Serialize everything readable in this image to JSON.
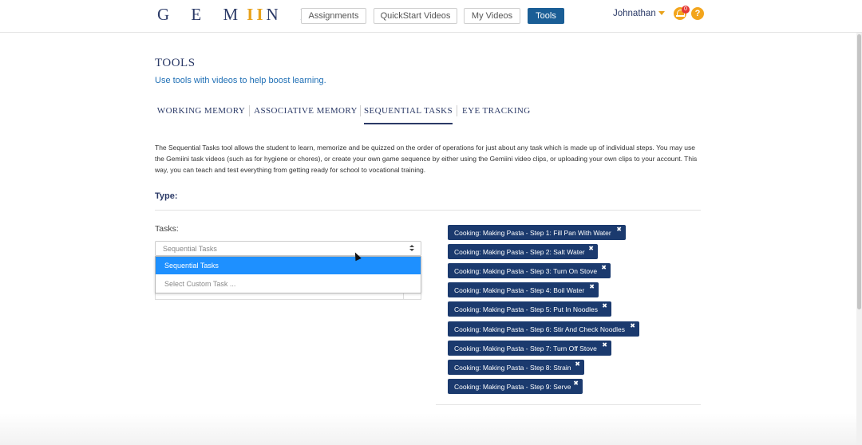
{
  "header": {
    "logo": "GEMIINI",
    "nav": [
      "Assignments",
      "QuickStart Videos",
      "My Videos",
      "Tools"
    ],
    "active_nav": "Tools",
    "user": "Johnathan",
    "notification_count": "0",
    "help_label": "?"
  },
  "page": {
    "title": "TOOLS",
    "subtitle": "Use tools with videos to help boost learning.",
    "tabs": [
      "WORKING MEMORY",
      "ASSOCIATIVE MEMORY",
      "SEQUENTIAL TASKS",
      "EYE TRACKING"
    ],
    "active_tab": "SEQUENTIAL TASKS",
    "description": "The Sequential Tasks tool allows the student to learn, memorize and be quizzed on the order of operations for just about any task which is made up of individual steps. You may use the Gemiini task videos (such as for hygiene or chores), or create your own game sequence by either using the Gemiini video clips, or uploading your own clips to your account. This way, you can teach and test everything from getting ready for school to vocational training.",
    "type_label": "Type:",
    "tasks_label": "Tasks:",
    "select": {
      "value": "Sequential Tasks",
      "options": [
        "Sequential Tasks",
        "Select Custom Task ..."
      ],
      "highlighted": "Sequential Tasks"
    },
    "chips": [
      "Cooking: Making Pasta - Step 1: Fill Pan With Water",
      "Cooking: Making Pasta - Step 2: Salt Water",
      "Cooking: Making Pasta - Step 3: Turn On Stove",
      "Cooking: Making Pasta - Step 4: Boil Water",
      "Cooking: Making Pasta - Step 5: Put In Noodles",
      "Cooking: Making Pasta - Step 6: Stir And Check Noodles",
      "Cooking: Making Pasta - Step 7: Turn Off Stove",
      "Cooking: Making Pasta - Step 8: Strain",
      "Cooking: Making Pasta - Step 9: Serve"
    ],
    "chip_remove": "✖"
  },
  "colors": {
    "brand_navy": "#2b3a67",
    "accent_orange": "#e8a21b",
    "active_blue": "#1a5e96",
    "chip_navy": "#1b3a6e",
    "option_highlight": "#1e90ff"
  }
}
